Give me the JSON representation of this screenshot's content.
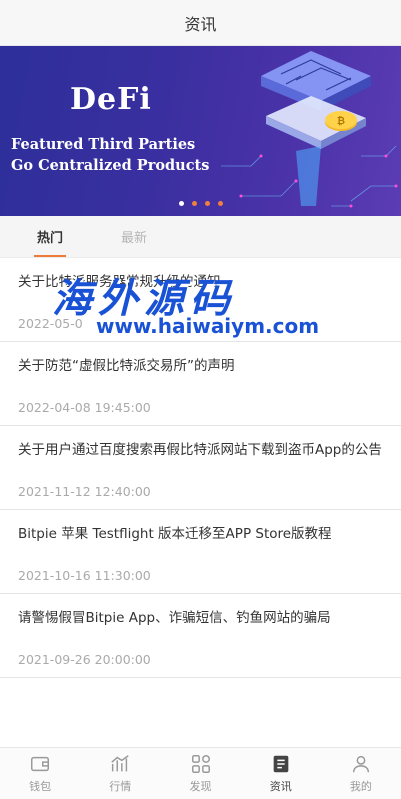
{
  "header": {
    "title": "资讯"
  },
  "banner": {
    "title": "DeFi",
    "subtitle": "Featured Third Parties Go Centralized Products",
    "active_dot": 1,
    "dot_count": 4
  },
  "tabs": [
    {
      "label": "热门",
      "active": true
    },
    {
      "label": "最新",
      "active": false
    }
  ],
  "news": [
    {
      "title": "关于比特派服务器常规升级的通知",
      "date": "2022-05-0"
    },
    {
      "title": "关于防范“虚假比特派交易所”的声明",
      "date": "2022-04-08 19:45:00"
    },
    {
      "title": "关于用户通过百度搜索再假比特派网站下载到盗币App的公告",
      "date": "2021-11-12 12:40:00"
    },
    {
      "title": "Bitpie 苹果 Testflight 版本迁移至APP Store版教程",
      "date": "2021-10-16 11:30:00"
    },
    {
      "title": "请警惕假冒Bitpie App、诈骗短信、钓鱼网站的骗局",
      "date": "2021-09-26 20:00:00"
    }
  ],
  "watermark": {
    "text": "海外源码",
    "url": "www.haiwaiym.com"
  },
  "bottom_nav": [
    {
      "label": "钱包",
      "icon": "wallet-icon",
      "active": false
    },
    {
      "label": "行情",
      "icon": "chart-icon",
      "active": false
    },
    {
      "label": "发现",
      "icon": "discover-icon",
      "active": false
    },
    {
      "label": "资讯",
      "icon": "news-icon",
      "active": true
    },
    {
      "label": "我的",
      "icon": "profile-icon",
      "active": false
    }
  ],
  "colors": {
    "accent": "#f07a3a",
    "banner_bg": "#3a2fa0",
    "watermark": "#1a52d6"
  }
}
